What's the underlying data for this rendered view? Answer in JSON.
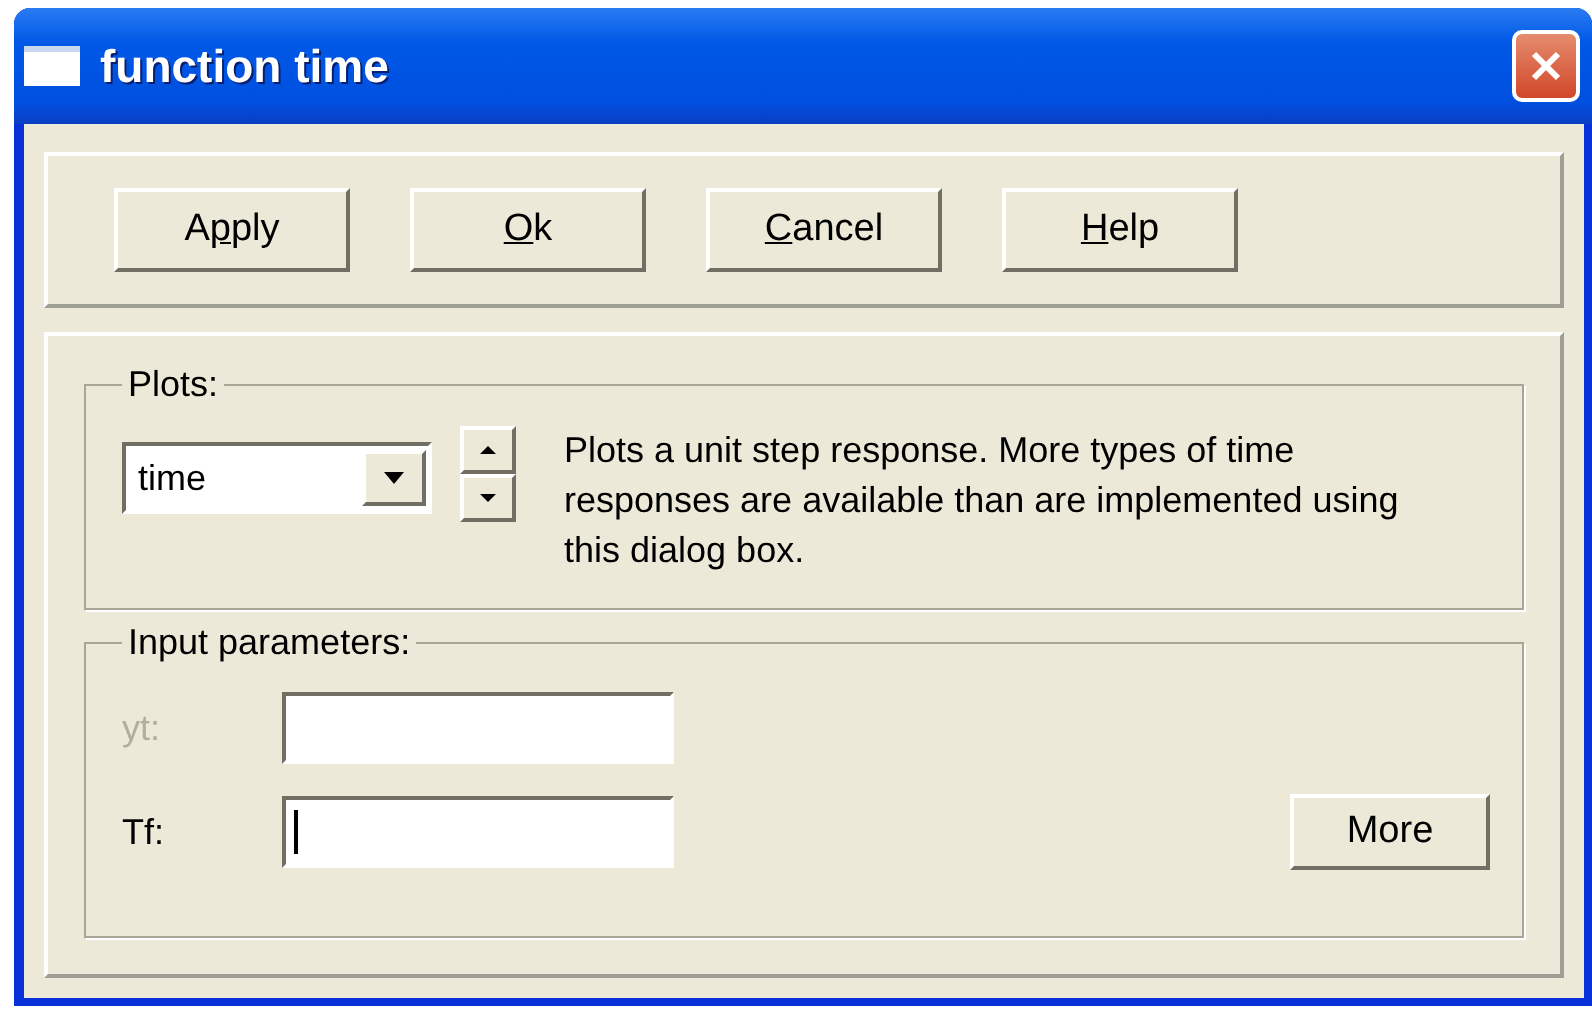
{
  "window": {
    "title": "function time"
  },
  "buttons": [
    {
      "before": "A",
      "mnemonic": "p",
      "after": "ply"
    },
    {
      "mnemonic": "O",
      "after": "k"
    },
    {
      "mnemonic": "C",
      "after": "ancel"
    },
    {
      "mnemonic": "H",
      "after": "elp"
    }
  ],
  "plots": {
    "legend": "Plots:",
    "dropdown": {
      "value": "time"
    },
    "description": "Plots a unit step response. More types of time responses are available than are implemented using this dialog box."
  },
  "inputs": {
    "legend": "Input parameters:",
    "fields": [
      {
        "label": "yt:",
        "disabled": true,
        "focused": false
      },
      {
        "label": "Tf:",
        "disabled": false,
        "focused": true
      }
    ],
    "more_button": "More"
  }
}
